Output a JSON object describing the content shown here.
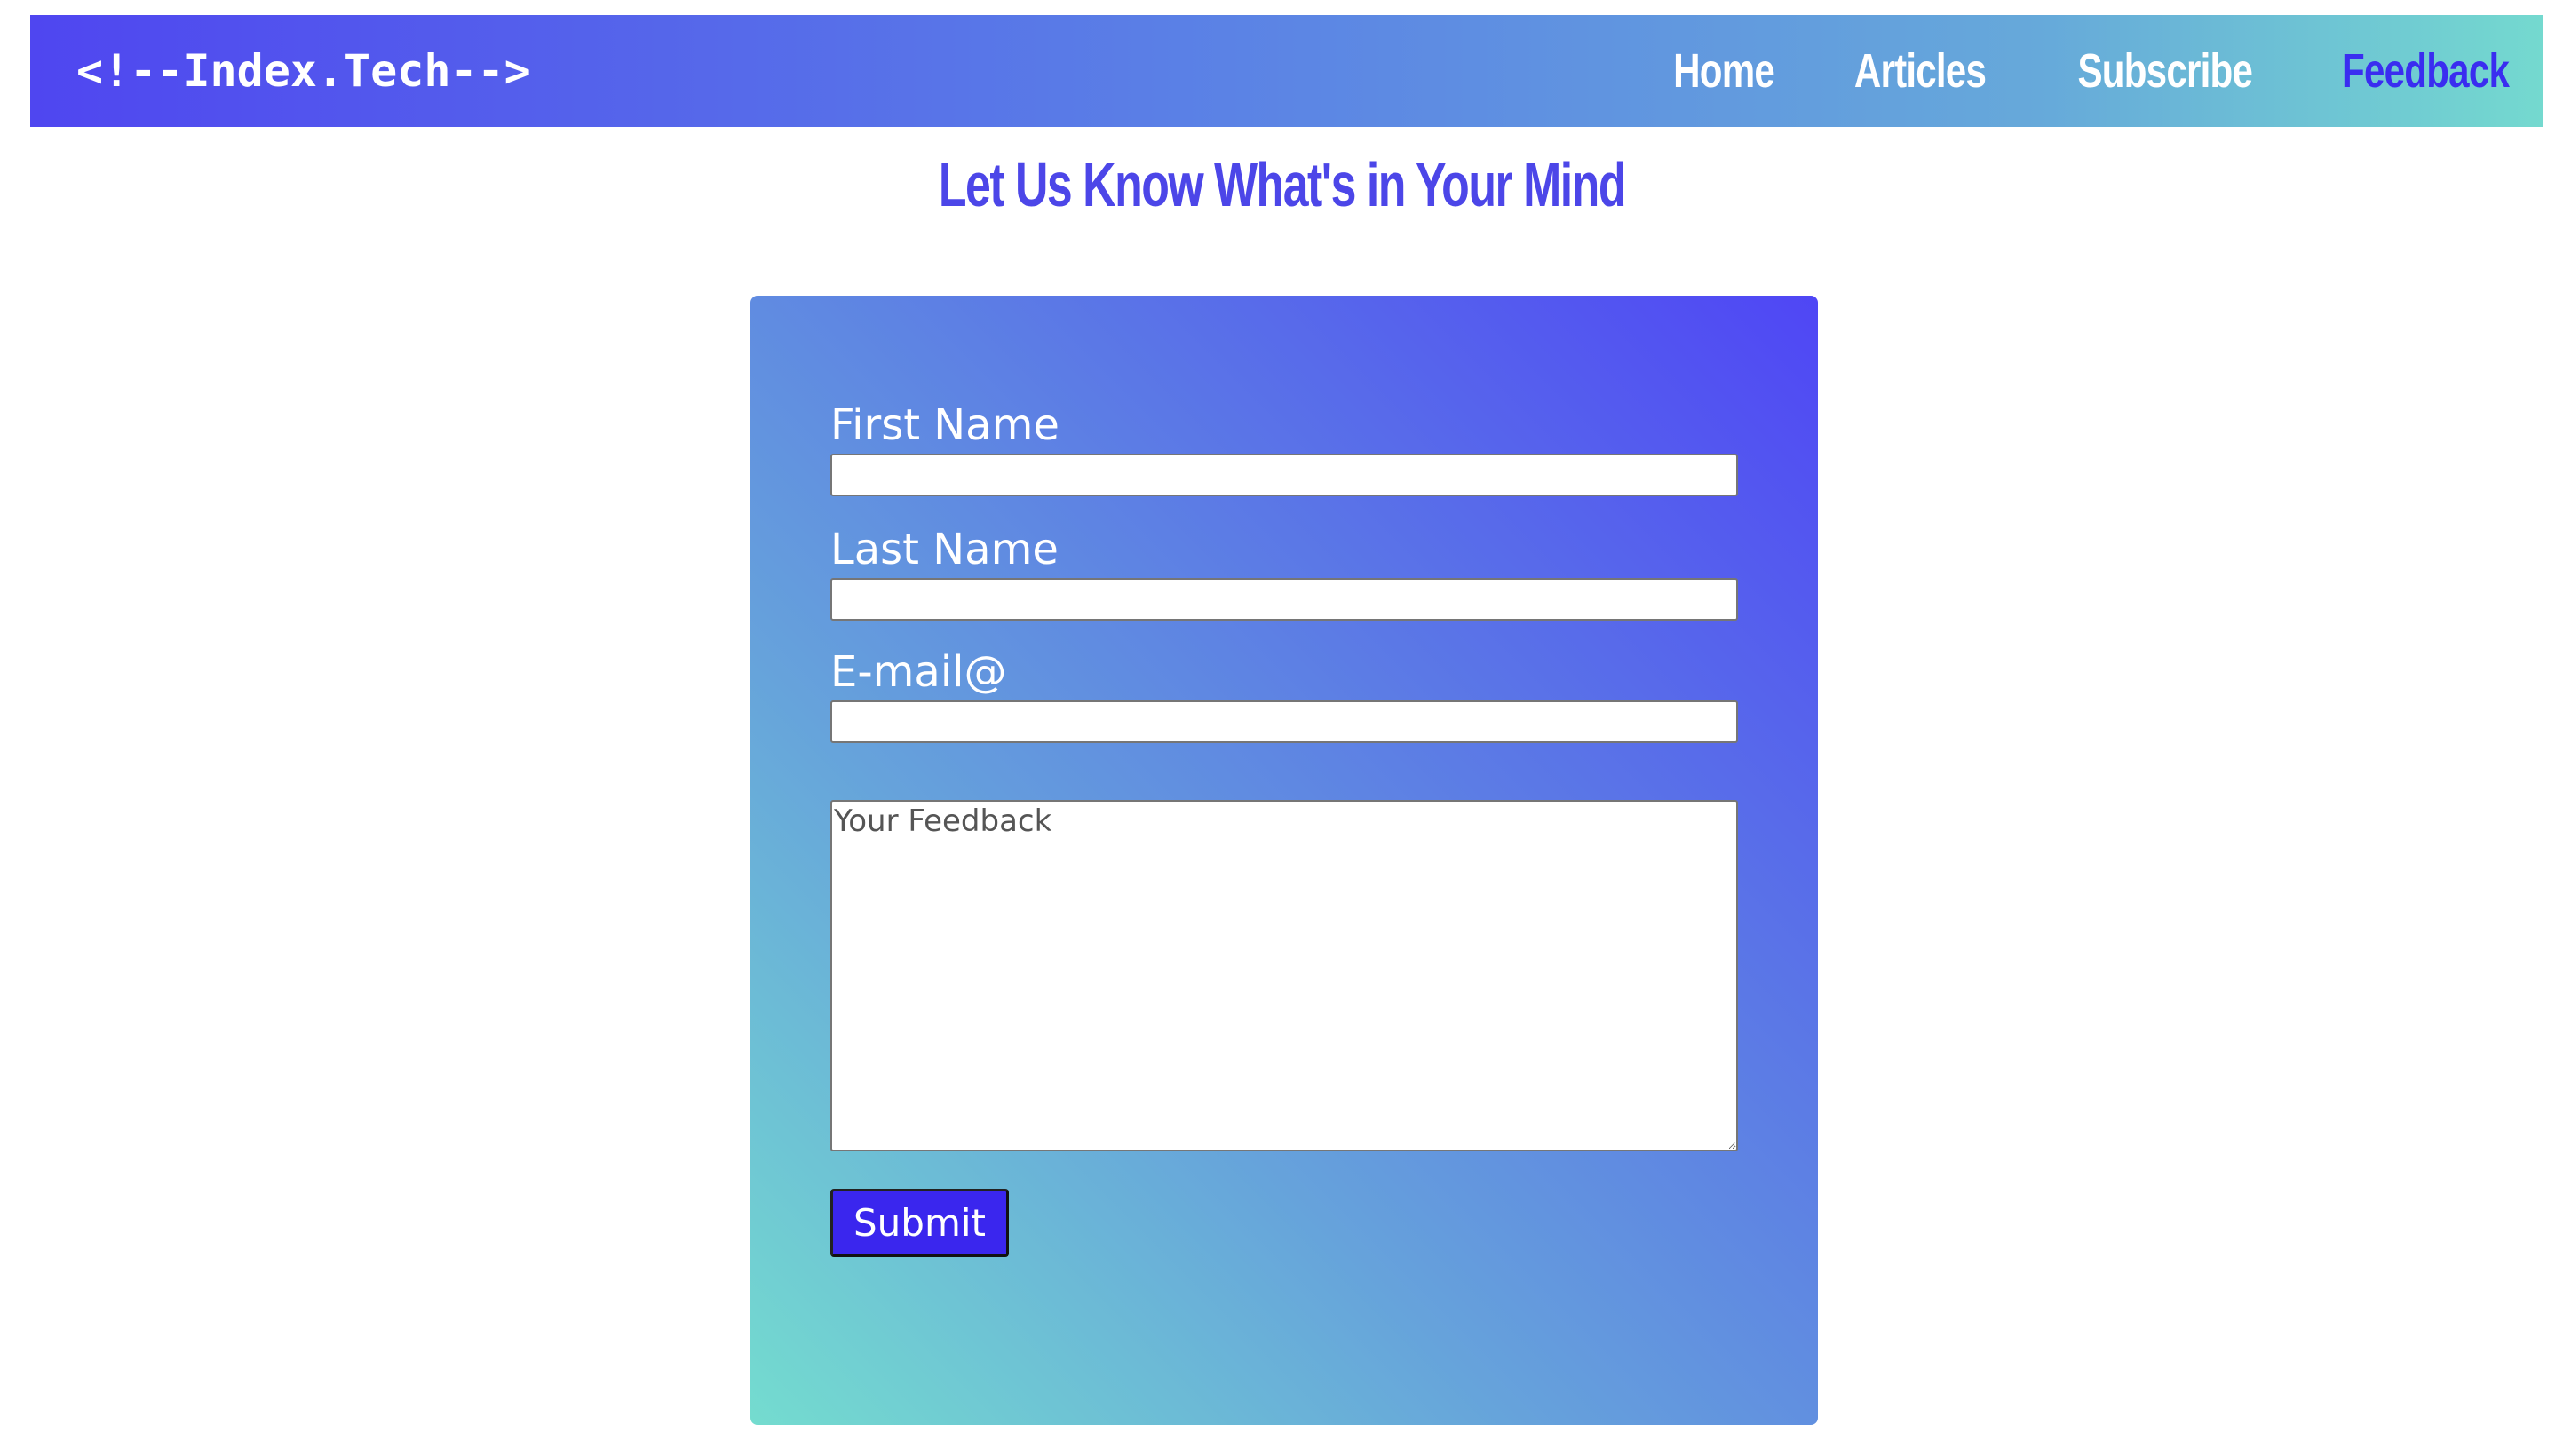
{
  "header": {
    "brand": "<!--Index.Tech-->",
    "nav": [
      {
        "label": "Home",
        "active": false
      },
      {
        "label": "Articles",
        "active": false
      },
      {
        "label": "Subscribe",
        "active": false
      },
      {
        "label": "Feedback",
        "active": true
      }
    ]
  },
  "page": {
    "title": "Let Us Know What's in Your Mind"
  },
  "form": {
    "first_name_label": "First Name",
    "first_name_value": "",
    "last_name_label": "Last Name",
    "last_name_value": "",
    "email_label": "E-mail@",
    "email_value": "",
    "feedback_placeholder": "Your Feedback",
    "submit_label": "Submit"
  },
  "colors": {
    "accent": "#4c46e8",
    "active_nav": "#3a2df0",
    "submit_bg": "#3a26ee",
    "gradient_start": "#4f46f0",
    "gradient_end": "#74d9cf"
  }
}
